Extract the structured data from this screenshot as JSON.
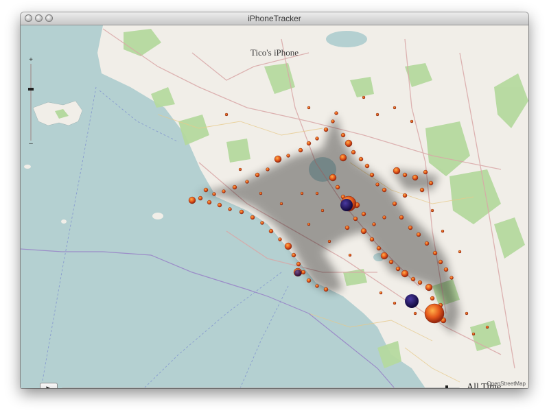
{
  "window": {
    "title": "iPhoneTracker"
  },
  "map": {
    "device_label": "Tico's iPhone",
    "attribution": "OpenStreetMap",
    "zoom_in_label": "+",
    "zoom_out_label": "–",
    "zoom_level_fraction": 0.68
  },
  "timeline": {
    "play_label": "▶",
    "time_label": "All Time",
    "position_fraction": 0.97
  },
  "colors": {
    "sea": "#b4d0d1",
    "land": "#f1eee8",
    "park": "#b5d99f",
    "road": "#d9a7a7",
    "dot": "#e2601a",
    "hotspot": "#2a1a6a"
  }
}
